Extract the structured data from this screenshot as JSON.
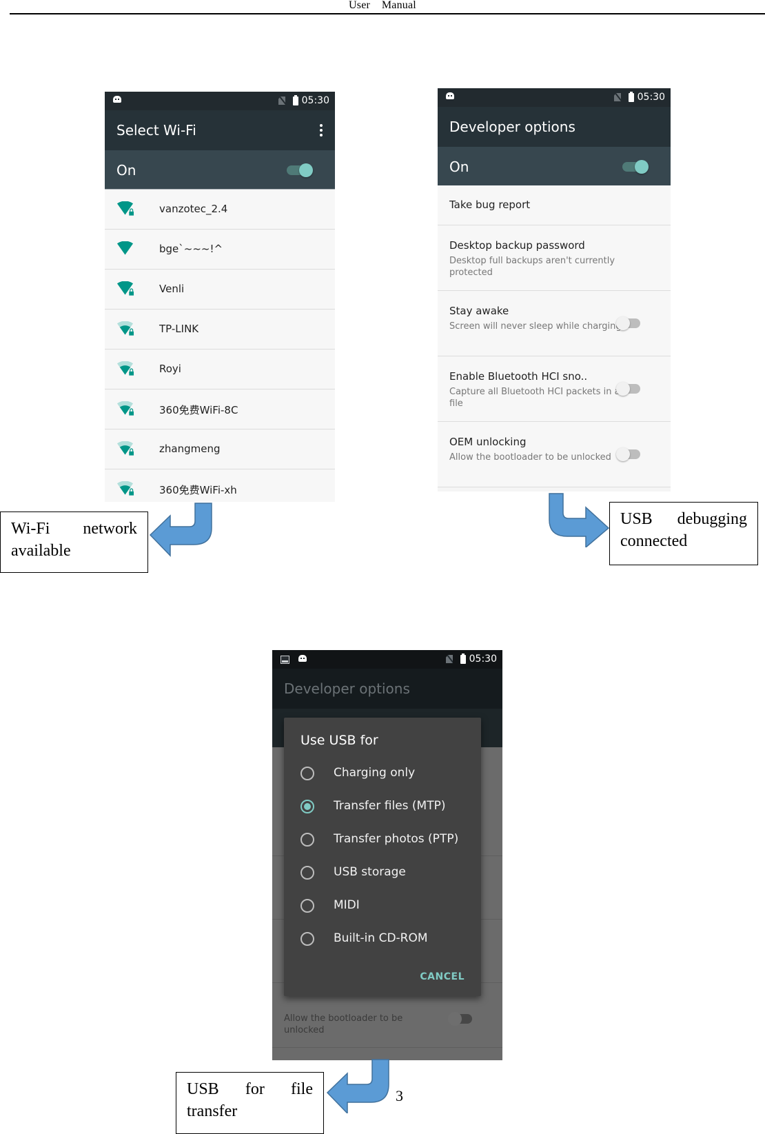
{
  "document": {
    "header": "User    Manual",
    "page_number": "3"
  },
  "status_bar": {
    "time": "05:30"
  },
  "wifi_screen": {
    "title": "Select Wi-Fi",
    "switch_label": "On",
    "switch_state": "on",
    "networks": [
      {
        "ssid": "vanzotec_2.4",
        "signal": "full",
        "secured": true
      },
      {
        "ssid": "bge`~~~!^",
        "signal": "full",
        "secured": false
      },
      {
        "ssid": "Venli",
        "signal": "full",
        "secured": true
      },
      {
        "ssid": "TP-LINK",
        "signal": "medium",
        "secured": true
      },
      {
        "ssid": "Royi",
        "signal": "medium",
        "secured": true
      },
      {
        "ssid": "360免费WiFi-8C",
        "signal": "medium",
        "secured": true
      },
      {
        "ssid": "zhangmeng",
        "signal": "medium",
        "secured": true
      },
      {
        "ssid": "360免费WiFi-xh",
        "signal": "medium",
        "secured": true
      }
    ],
    "callout": {
      "word1": "Wi-Fi",
      "word2": "network",
      "line2": "available"
    }
  },
  "developer_screen": {
    "title": "Developer options",
    "switch_label": "On",
    "switch_state": "on",
    "items": [
      {
        "title": "Take bug report"
      },
      {
        "title": "Desktop backup password",
        "subtitle": "Desktop full backups aren't currently protected"
      },
      {
        "title": "Stay awake",
        "subtitle": "Screen will never sleep while charging",
        "toggle": "off"
      },
      {
        "title": "Enable Bluetooth HCI sno..",
        "subtitle": "Capture all Bluetooth HCI packets in a file",
        "toggle": "off"
      },
      {
        "title": "OEM unlocking",
        "subtitle": "Allow the bootloader to be unlocked",
        "toggle": "off"
      }
    ],
    "callout": {
      "word1": "USB",
      "word2": "debugging",
      "line2": "connected"
    }
  },
  "usb_screen": {
    "background_title": "Developer options",
    "background_subtitle": "Allow the bootloader to be unlocked",
    "dialog": {
      "title": "Use USB for",
      "options": [
        {
          "label": "Charging only",
          "selected": false
        },
        {
          "label": "Transfer files (MTP)",
          "selected": true
        },
        {
          "label": "Transfer photos (PTP)",
          "selected": false
        },
        {
          "label": "USB storage",
          "selected": false
        },
        {
          "label": "MIDI",
          "selected": false
        },
        {
          "label": "Built-in CD-ROM",
          "selected": false
        }
      ],
      "cancel_label": "CANCEL"
    },
    "callout": {
      "word1": "USB",
      "word2": "for",
      "word3": "file",
      "line2": "transfer"
    }
  },
  "colors": {
    "accent": "#80cbc4",
    "wifi_teal": "#009688",
    "wifi_teal_light": "#b2dfdb",
    "arrow_blue": "#5b9bd5",
    "appbar": "#263238",
    "switchbar": "#37474f"
  }
}
